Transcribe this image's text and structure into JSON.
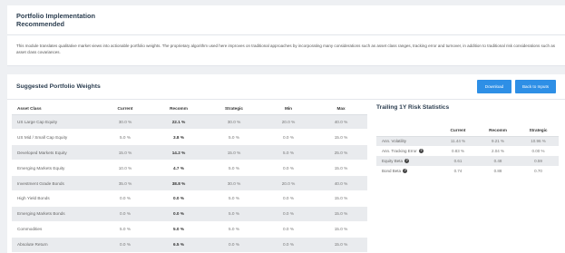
{
  "header": {
    "title_line1": "Portfolio Implementation",
    "title_line2": "Recommended"
  },
  "description": "This module translates qualitative market views into actionable portfolio weights. The proprietary algorithm used here improves on traditional approaches by incorporating many considerations such as asset class ranges, tracking error and turnover, in addition to traditional risk considerations such as asset class covariances.",
  "main": {
    "title": "Suggested Portfolio Weights",
    "download_label": "Download",
    "back_label": "Back to Inputs"
  },
  "weights": {
    "columns": [
      "Asset Class",
      "Current",
      "Recomm",
      "Strategic",
      "Min",
      "Max"
    ],
    "rows": [
      [
        "US Large Cap Equity",
        "30.0 %",
        "22.1 %",
        "30.0 %",
        "20.0 %",
        "40.0 %"
      ],
      [
        "US Mid / Small Cap Equity",
        "5.0 %",
        "3.8 %",
        "5.0 %",
        "0.0 %",
        "15.0 %"
      ],
      [
        "Developed Markets Equity",
        "15.0 %",
        "14.2 %",
        "15.0 %",
        "5.0 %",
        "25.0 %"
      ],
      [
        "Emerging Markets Equity",
        "10.0 %",
        "4.7 %",
        "5.0 %",
        "0.0 %",
        "15.0 %"
      ],
      [
        "Investment Grade Bonds",
        "35.0 %",
        "38.8 %",
        "30.0 %",
        "20.0 %",
        "40.0 %"
      ],
      [
        "High Yield Bonds",
        "0.0 %",
        "0.0 %",
        "5.0 %",
        "0.0 %",
        "15.0 %"
      ],
      [
        "Emerging Markets Bonds",
        "0.0 %",
        "0.0 %",
        "5.0 %",
        "0.0 %",
        "15.0 %"
      ],
      [
        "Commodities",
        "5.0 %",
        "5.0 %",
        "5.0 %",
        "0.0 %",
        "15.0 %"
      ],
      [
        "Absolute Return",
        "0.0 %",
        "6.5 %",
        "0.0 %",
        "0.0 %",
        "15.0 %"
      ]
    ]
  },
  "risk": {
    "title": "Trailing 1Y Risk Statistics",
    "columns": [
      "",
      "Current",
      "Recomm",
      "Strategic"
    ],
    "rows": [
      [
        "Ann. Volatility",
        "11.44 %",
        "9.21 %",
        "10.96 %"
      ],
      [
        "Ann. Tracking Error",
        "0.83 %",
        "2.04 %",
        "0.00 %"
      ],
      [
        "Equity Beta",
        "0.61",
        "0.48",
        "0.59"
      ],
      [
        "Bond Beta",
        "0.74",
        "0.88",
        "0.70"
      ]
    ],
    "help_icon_glyph": "?"
  }
}
